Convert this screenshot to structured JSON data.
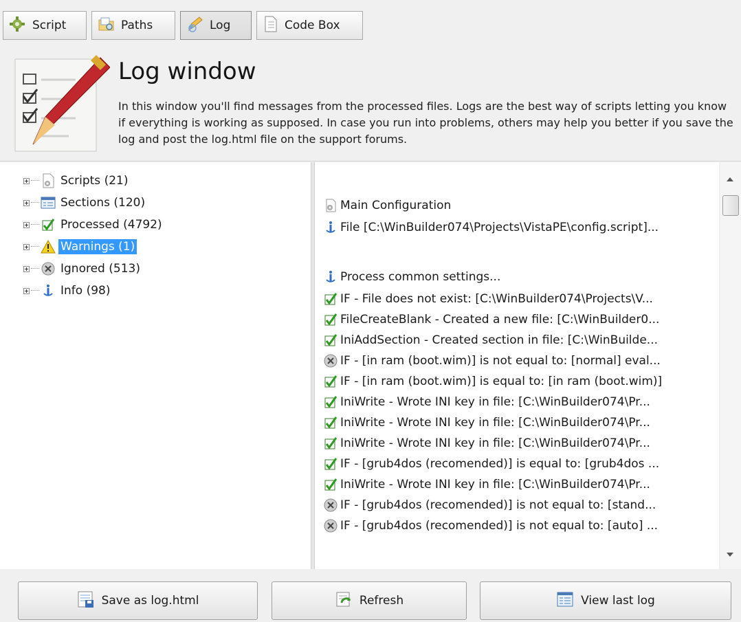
{
  "tabs": [
    {
      "label": "Script",
      "icon": "gear-puzzle-icon"
    },
    {
      "label": "Paths",
      "icon": "folder-search-icon"
    },
    {
      "label": "Log",
      "icon": "pencil-icon",
      "active": true
    },
    {
      "label": "Code Box",
      "icon": "document-icon"
    }
  ],
  "header": {
    "title": "Log window",
    "description": "In this window you'll find messages from the processed files. Logs are the best way of scripts letting you know if everything is working as supposed. In case you run into problems, others may help you better if you save the log and post the log.html file on the support forums."
  },
  "tree": [
    {
      "label": "Scripts (21)",
      "icon": "script-icon"
    },
    {
      "label": "Sections (120)",
      "icon": "sections-icon"
    },
    {
      "label": "Processed (4792)",
      "icon": "checkmark-icon"
    },
    {
      "label": "Warnings (1)",
      "icon": "warning-icon",
      "selected": true
    },
    {
      "label": "Ignored (513)",
      "icon": "ignored-icon"
    },
    {
      "label": "Info (98)",
      "icon": "info-icon"
    }
  ],
  "log": [
    {
      "text": "Main Configuration",
      "icon": "script-icon"
    },
    {
      "text": "File [C:\\WinBuilder074\\Projects\\VistaPE\\config.script]...",
      "icon": "info-icon"
    },
    {
      "text": "Process common settings...",
      "icon": "info-icon"
    },
    {
      "text": "IF - File does not exist: [C:\\WinBuilder074\\Projects\\V...",
      "icon": "checkmark-icon"
    },
    {
      "text": "FileCreateBlank - Created a new file: [C:\\WinBuilder0...",
      "icon": "checkmark-icon"
    },
    {
      "text": "IniAddSection - Created section in file: [C:\\WinBuilde...",
      "icon": "checkmark-icon"
    },
    {
      "text": "IF - [in ram (boot.wim)] is not equal to: [normal] eval...",
      "icon": "ignored-icon"
    },
    {
      "text": "IF - [in ram (boot.wim)] is equal to: [in ram (boot.wim)]",
      "icon": "checkmark-icon"
    },
    {
      "text": "IniWrite - Wrote INI key in file: [C:\\WinBuilder074\\Pr...",
      "icon": "checkmark-icon"
    },
    {
      "text": "IniWrite - Wrote INI key in file: [C:\\WinBuilder074\\Pr...",
      "icon": "checkmark-icon"
    },
    {
      "text": "IniWrite - Wrote INI key in file: [C:\\WinBuilder074\\Pr...",
      "icon": "checkmark-icon"
    },
    {
      "text": "IF - [grub4dos (recomended)] is equal to: [grub4dos ...",
      "icon": "checkmark-icon"
    },
    {
      "text": "IniWrite - Wrote INI key in file: [C:\\WinBuilder074\\Pr...",
      "icon": "checkmark-icon"
    },
    {
      "text": "IF - [grub4dos (recomended)] is not equal to: [stand...",
      "icon": "ignored-icon"
    },
    {
      "text": "IF - [grub4dos (recomended)] is not equal to: [auto] ...",
      "icon": "ignored-icon"
    }
  ],
  "buttons": {
    "save": "Save as log.html",
    "refresh": "Refresh",
    "view_last": "View last log"
  }
}
